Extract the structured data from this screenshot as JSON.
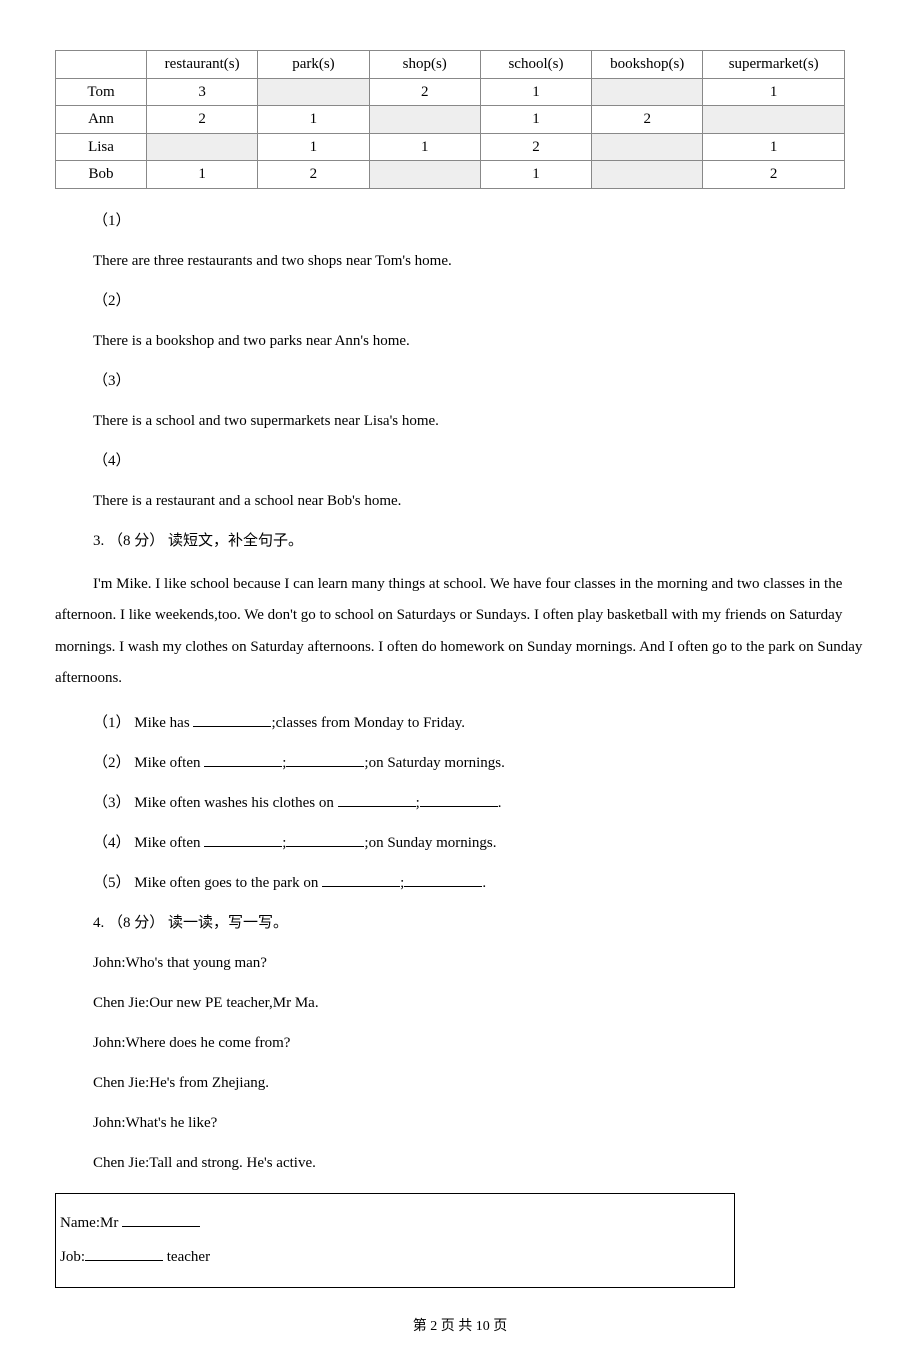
{
  "chart_data": {
    "type": "table",
    "headers": [
      "",
      "restaurant(s)",
      "park(s)",
      "shop(s)",
      "school(s)",
      "bookshop(s)",
      "supermarket(s)"
    ],
    "rows": [
      {
        "name": "Tom",
        "vals": [
          "3",
          "",
          "2",
          "1",
          "",
          "1"
        ]
      },
      {
        "name": "Ann",
        "vals": [
          "2",
          "1",
          "",
          "1",
          "2",
          ""
        ]
      },
      {
        "name": "Lisa",
        "vals": [
          "",
          "1",
          "1",
          "2",
          "",
          "1"
        ]
      },
      {
        "name": "Bob",
        "vals": [
          "1",
          "2",
          "",
          "1",
          "",
          "2"
        ]
      }
    ]
  },
  "statements": [
    {
      "num": "（1）",
      "text": "There are three restaurants and two shops near Tom's home."
    },
    {
      "num": "（2）",
      "text": "There is a bookshop and two parks near Ann's home."
    },
    {
      "num": "（3）",
      "text": "There is a school and two supermarkets near Lisa's home."
    },
    {
      "num": "（4）",
      "text": "There is a restaurant and a school near Bob's home."
    }
  ],
  "q3": {
    "heading": "3. （8 分） 读短文，补全句子。",
    "passage": "I'm Mike. I like school because I can learn many things at school. We have four classes in the morning and two classes in the afternoon. I like weekends,too. We don't go to school on Saturdays or Sundays. I often play basketball with my friends on Saturday mornings. I wash my clothes on Saturday afternoons. I often do homework on Sunday mornings. And I often go to the park on Sunday afternoons.",
    "items": [
      {
        "num": "（1）",
        "pre": " Mike has ",
        "blanks": 1,
        "mid": ";classes from Monday to Friday.",
        "post": ""
      },
      {
        "num": "（2）",
        "pre": " Mike often ",
        "blanks": 2,
        "sep": ";",
        "post": ";on Saturday mornings."
      },
      {
        "num": "（3）",
        "pre": " Mike often washes his clothes on ",
        "blanks": 2,
        "sep": ";",
        "post": "."
      },
      {
        "num": "（4）",
        "pre": " Mike often ",
        "blanks": 2,
        "sep": ";",
        "post": ";on Sunday mornings."
      },
      {
        "num": "（5）",
        "pre": " Mike often goes to the park on ",
        "blanks": 2,
        "sep": ";",
        "post": "."
      }
    ]
  },
  "q4": {
    "heading": "4. （8 分） 读一读，写一写。",
    "dialogue": [
      "John:Who's that young man?",
      "Chen Jie:Our new PE teacher,Mr Ma.",
      "John:Where does he come from?",
      "Chen Jie:He's from Zhejiang.",
      "John:What's he like?",
      "Chen Jie:Tall and strong. He's active."
    ],
    "form": {
      "name_label": "Name:Mr ",
      "job_label": "Job:",
      "job_suffix": " teacher"
    }
  },
  "footer": "第 2 页 共 10 页"
}
